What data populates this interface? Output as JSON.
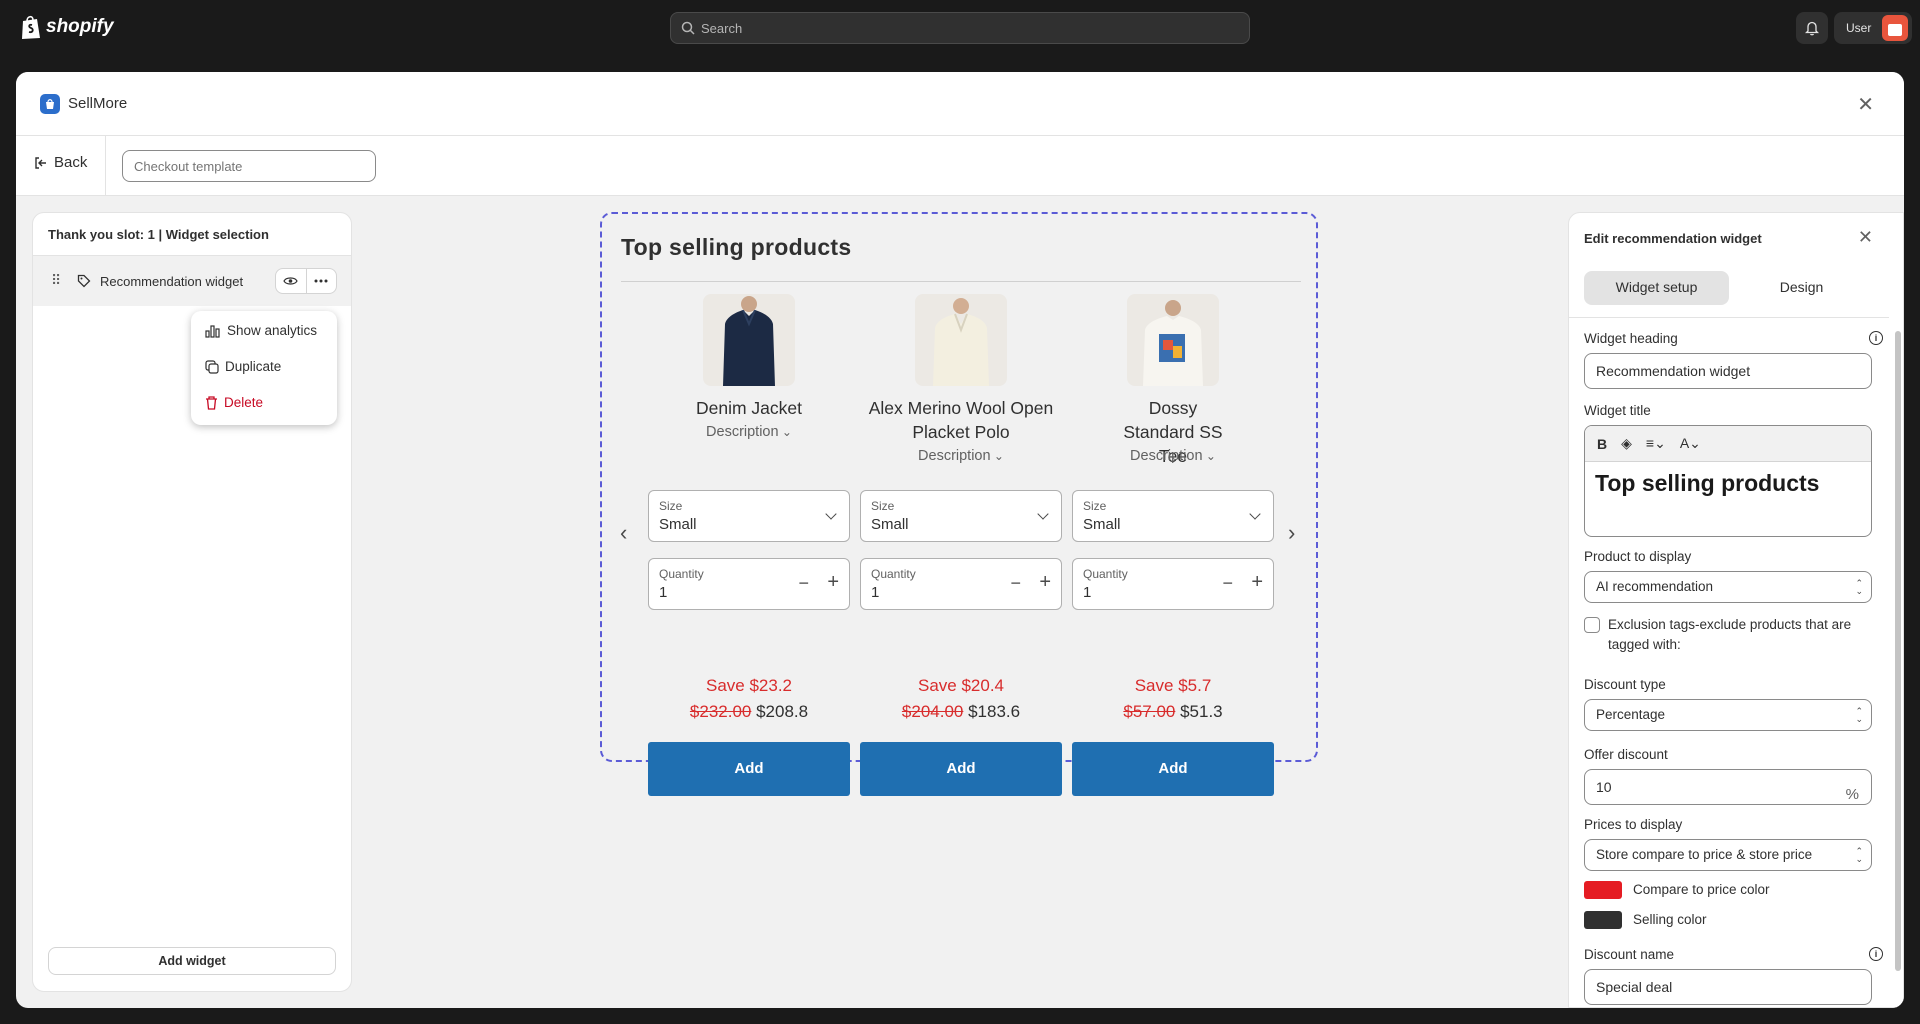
{
  "topbar": {
    "brand": "shopify",
    "search_placeholder": "Search",
    "user_label": "User"
  },
  "modal": {
    "app_name": "SellMore",
    "back_label": "Back",
    "template_placeholder": "Checkout template"
  },
  "left_panel": {
    "title": "Thank you slot: 1 | Widget selection",
    "widget_label": "Recommendation widget",
    "menu": [
      "Show analytics",
      "Duplicate",
      "Delete"
    ],
    "add_widget_label": "Add widget"
  },
  "preview": {
    "title": "Top selling products",
    "products": [
      {
        "name": "Denim Jacket",
        "description_label": "Description",
        "size_label": "Size",
        "size_value": "Small",
        "quantity_label": "Quantity",
        "quantity_value": "1",
        "save_text": "Save $23.2",
        "compare_price": "$232.00",
        "price": "$208.8",
        "add_label": "Add",
        "image_colors": {
          "bg": "#ece9e4",
          "item": "#1c2a44"
        }
      },
      {
        "name": "Alex Merino Wool Open Placket Polo",
        "description_label": "Description",
        "size_label": "Size",
        "size_value": "Small",
        "quantity_label": "Quantity",
        "quantity_value": "1",
        "save_text": "Save $20.4",
        "compare_price": "$204.00",
        "price": "$183.6",
        "add_label": "Add",
        "image_colors": {
          "bg": "#ece9e4",
          "item": "#f3efe0"
        }
      },
      {
        "name": "Dossy Standard SS Tee",
        "description_label": "Description",
        "size_label": "Size",
        "size_value": "Small",
        "quantity_label": "Quantity",
        "quantity_value": "1",
        "save_text": "Save $5.7",
        "compare_price": "$57.00",
        "price": "$51.3",
        "add_label": "Add",
        "image_colors": {
          "bg": "#ece9e4",
          "item": "#f7f5f0"
        }
      }
    ]
  },
  "right_panel": {
    "title": "Edit recommendation widget",
    "tabs": [
      "Widget setup",
      "Design"
    ],
    "widget_heading_label": "Widget heading",
    "widget_heading_value": "Recommendation widget",
    "widget_title_label": "Widget title",
    "widget_title_value": "Top selling products",
    "product_display_label": "Product to display",
    "product_display_value": "AI recommendation",
    "exclusion_label": "Exclusion tags-exclude products that are tagged with:",
    "discount_type_label": "Discount type",
    "discount_type_value": "Percentage",
    "offer_discount_label": "Offer discount",
    "offer_discount_value": "10",
    "offer_discount_suffix": "%",
    "prices_label": "Prices to display",
    "prices_value": "Store compare to price & store price",
    "compare_color_label": "Compare to price color",
    "compare_color": "#e51c23",
    "selling_color_label": "Selling color",
    "selling_color": "#303030",
    "discount_name_label": "Discount name",
    "discount_name_value": "Special deal"
  },
  "colors": {
    "accent_button": "#1f6fb1",
    "discount_red": "#d82c2c",
    "preview_border": "#5b5bd6"
  }
}
